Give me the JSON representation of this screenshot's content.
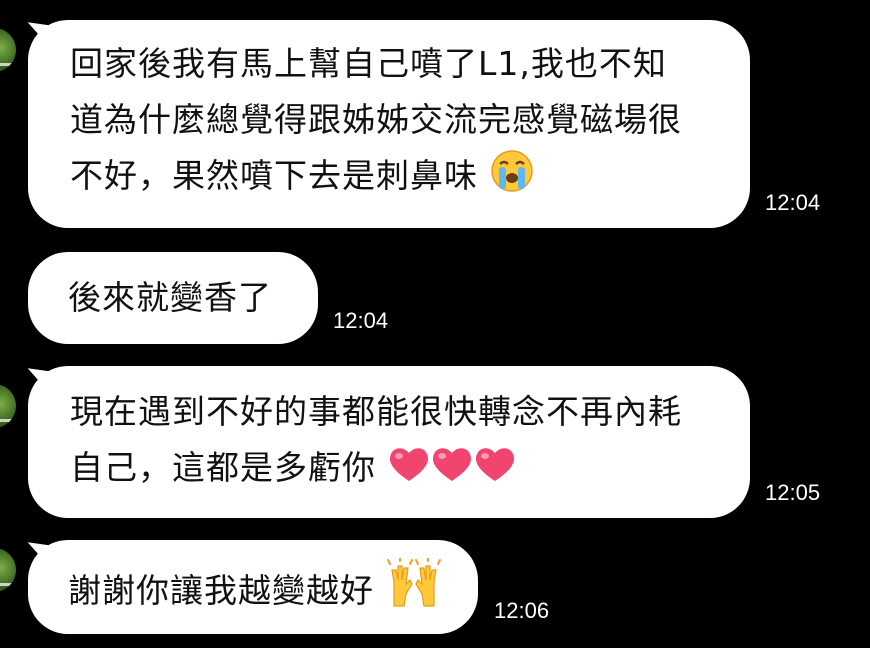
{
  "messages": [
    {
      "lines": [
        "回家後我有馬上幫自己噴了L1,我也不知",
        "道為什麼總覺得跟姊姊交流完感覺磁場很",
        "不好，果然噴下去是刺鼻味"
      ],
      "emoji": "loudly-crying-face-icon",
      "time": "12:04"
    },
    {
      "lines": [
        "後來就變香了"
      ],
      "time": "12:04"
    },
    {
      "lines": [
        "現在遇到不好的事都能很快轉念不再內耗",
        "自己，這都是多虧你"
      ],
      "emoji": "three-pink-hearts-icon",
      "time": "12:05"
    },
    {
      "lines": [
        "謝謝你讓我越變越好"
      ],
      "emoji": "raising-hands-icon",
      "time": "12:06"
    }
  ],
  "colors": {
    "background": "#000000",
    "bubble": "#ffffff",
    "text": "#111111",
    "time": "#ffffff",
    "heart": "#f0456e",
    "emoji_yellow": "#ffc93a"
  }
}
